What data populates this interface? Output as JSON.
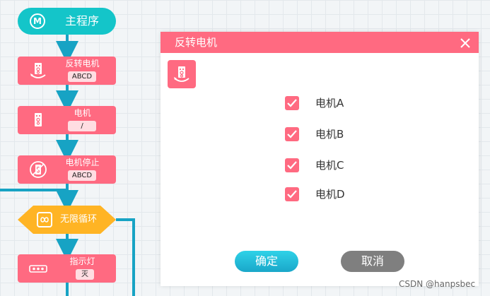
{
  "flowchart": {
    "start_label": "主程序",
    "start_icon_letter": "M",
    "blocks": [
      {
        "title": "反转电机",
        "param": "ABCD",
        "icon": "motor-reverse-icon"
      },
      {
        "title": "电机",
        "param": "/",
        "icon": "motor-icon"
      },
      {
        "title": "电机停止",
        "param": "ABCD",
        "icon": "motor-stop-icon"
      },
      {
        "title": "指示灯",
        "param": "灭",
        "icon": "indicator-light-icon"
      }
    ],
    "loop_label": "无限循环",
    "colors": {
      "start": "#14c5c9",
      "block": "#ff6a81",
      "loop": "#ffb424",
      "connector": "#17a3c4"
    }
  },
  "dialog": {
    "title": "反转电机",
    "icon": "motor-reverse-icon",
    "options": [
      {
        "label": "电机A",
        "checked": true
      },
      {
        "label": "电机B",
        "checked": true
      },
      {
        "label": "电机C",
        "checked": true
      },
      {
        "label": "电机D",
        "checked": true
      }
    ],
    "confirm_label": "确定",
    "cancel_label": "取消",
    "colors": {
      "header": "#ff6a81",
      "confirm": "#1fb8d8",
      "cancel": "#7f7f7f"
    }
  },
  "watermark": "CSDN @hanpsbec"
}
